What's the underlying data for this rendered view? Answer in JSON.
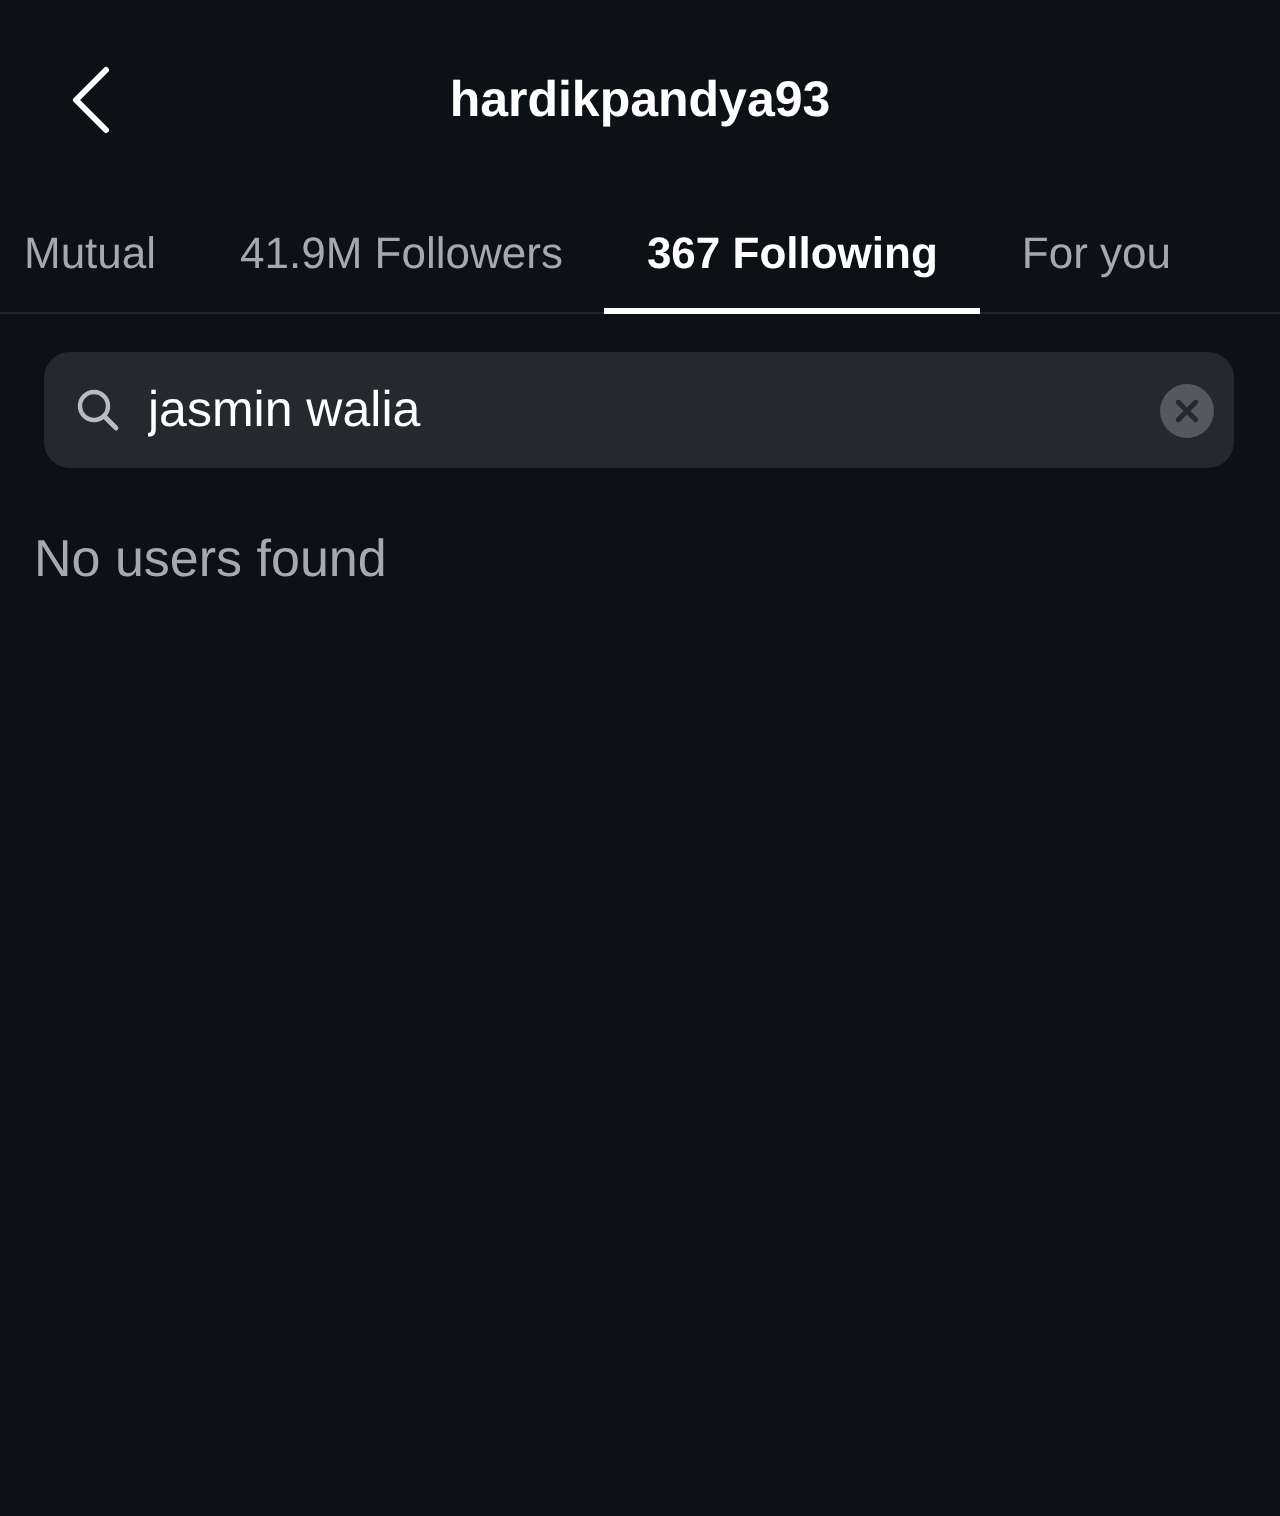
{
  "header": {
    "title": "hardikpandya93"
  },
  "tabs": [
    {
      "label": "Mutual",
      "selected": false
    },
    {
      "label": "41.9M Followers",
      "selected": false
    },
    {
      "label": "367 Following",
      "selected": true
    },
    {
      "label": "For you",
      "selected": false
    }
  ],
  "search": {
    "value": "jasmin walia"
  },
  "empty_message": "No users found"
}
